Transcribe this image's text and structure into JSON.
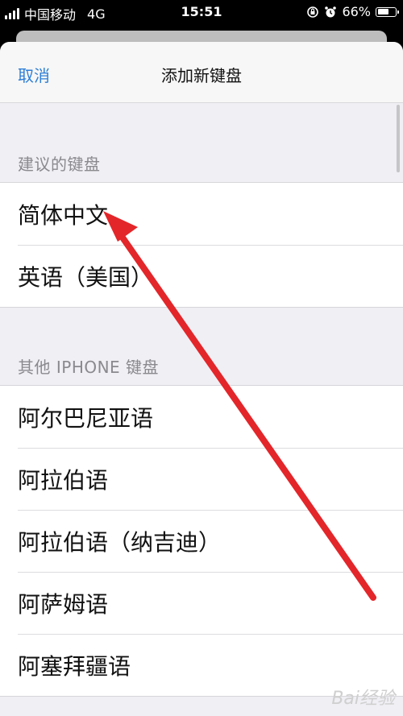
{
  "status_bar": {
    "carrier": "中国移动",
    "network": "4G",
    "time": "15:51",
    "battery_text": "66%",
    "battery_level": 0.66
  },
  "nav": {
    "cancel_label": "取消",
    "title": "添加新键盘"
  },
  "sections": [
    {
      "header": "建议的键盘",
      "items": [
        "简体中文",
        "英语（美国）"
      ]
    },
    {
      "header": "其他 IPHONE 键盘",
      "items": [
        "阿尔巴尼亚语",
        "阿拉伯语",
        "阿拉伯语（纳吉迪）",
        "阿萨姆语",
        "阿塞拜疆语"
      ]
    }
  ],
  "annotation": {
    "color": "#e3262a"
  },
  "watermark": "Bai经验"
}
